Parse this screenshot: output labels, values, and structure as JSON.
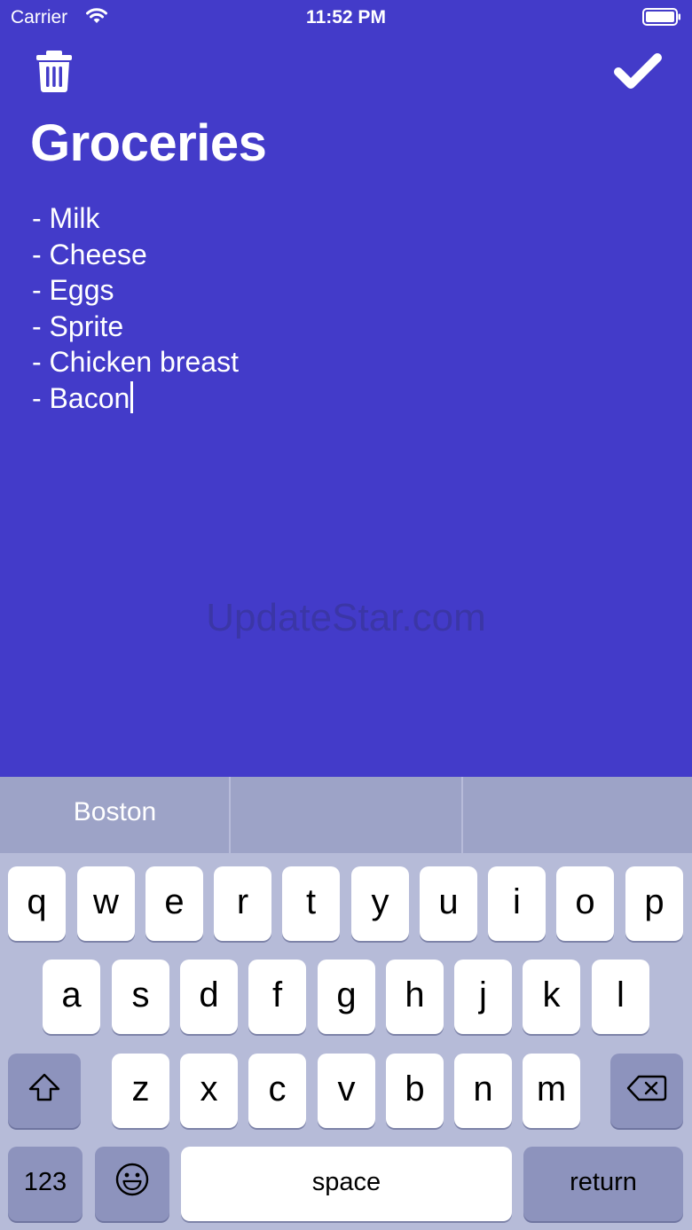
{
  "status_bar": {
    "carrier": "Carrier",
    "time": "11:52 PM",
    "icons": [
      "wifi-icon",
      "battery-icon"
    ]
  },
  "toolbar": {
    "left_icon": "trash-icon",
    "right_icon": "checkmark-icon"
  },
  "note": {
    "title": "Groceries",
    "lines": [
      "- Milk",
      "- Cheese",
      "- Eggs",
      "- Sprite",
      "- Chicken breast",
      "- Bacon"
    ],
    "background_color": "#433bc9"
  },
  "watermark": "UpdateStar.com",
  "keyboard": {
    "suggestions": [
      "Boston",
      "",
      ""
    ],
    "row1": [
      "q",
      "w",
      "e",
      "r",
      "t",
      "y",
      "u",
      "i",
      "o",
      "p"
    ],
    "row2": [
      "a",
      "s",
      "d",
      "f",
      "g",
      "h",
      "j",
      "k",
      "l"
    ],
    "row3": [
      "z",
      "x",
      "c",
      "v",
      "b",
      "n",
      "m"
    ],
    "shift_icon": "shift-icon",
    "delete_icon": "delete-icon",
    "numbers_label": "123",
    "emoji_icon": "emoji-icon",
    "space_label": "space",
    "return_label": "return"
  }
}
